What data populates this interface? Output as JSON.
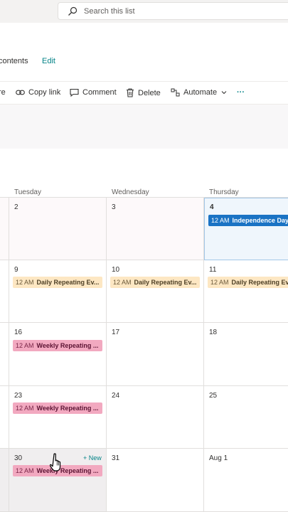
{
  "search": {
    "placeholder": "Search this list"
  },
  "nav": {
    "site_contents": "contents",
    "edit": "Edit"
  },
  "commands": {
    "share_partial": "re",
    "copy_link": "Copy link",
    "comment": "Comment",
    "delete": "Delete",
    "automate": "Automate",
    "more": "···"
  },
  "calendar": {
    "days": [
      "Tuesday",
      "Wednesday",
      "Thursday"
    ],
    "weeks": [
      {
        "dates": [
          "2",
          "3",
          "4"
        ]
      },
      {
        "dates": [
          "9",
          "10",
          "11"
        ]
      },
      {
        "dates": [
          "16",
          "17",
          "18"
        ]
      },
      {
        "dates": [
          "23",
          "24",
          "25"
        ]
      },
      {
        "dates": [
          "30",
          "31",
          "Aug 1"
        ]
      }
    ],
    "events": {
      "independence": {
        "time": "12 AM",
        "title": "Independence Day"
      },
      "daily": {
        "time": "12 AM",
        "title": "Daily Repeating Ev..."
      },
      "weekly": {
        "time": "12 AM",
        "title": "Weekly Repeating ..."
      }
    },
    "new_label": "+ New"
  },
  "colors": {
    "accent": "#038387",
    "today_event": "#1a73c4",
    "daily_event": "#fde7c3",
    "weekly_event": "#f2a9c0"
  }
}
